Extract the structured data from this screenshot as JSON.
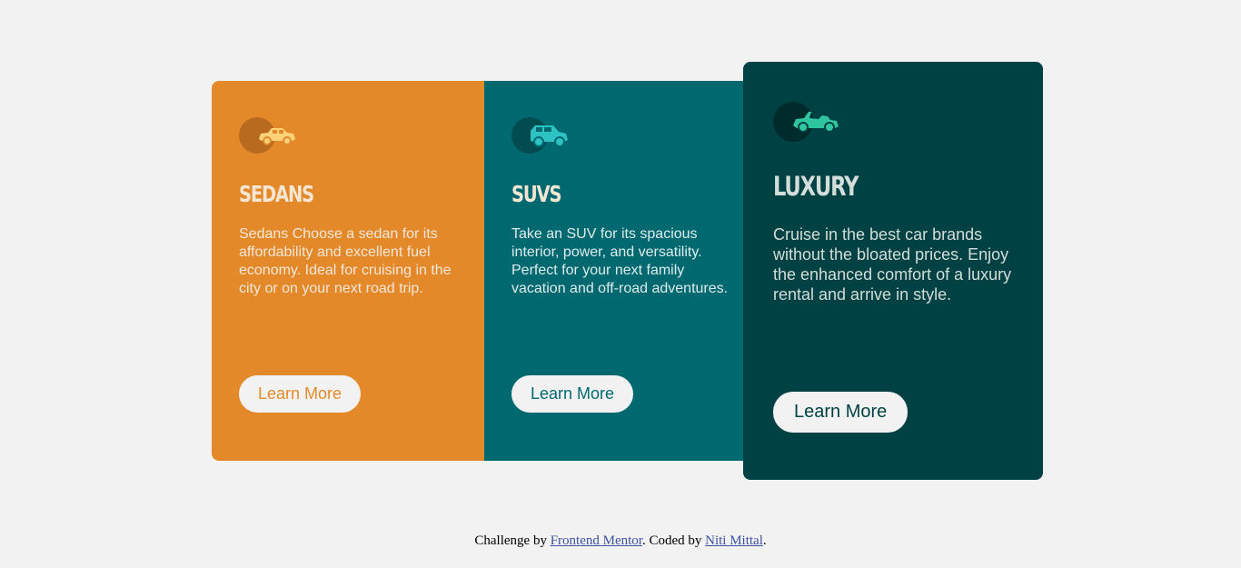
{
  "cards": [
    {
      "id": "sedans",
      "icon": "sedan-car-icon",
      "title": "SEDANS",
      "description": "Sedans Choose a sedan for its affordability and excellent fuel economy. Ideal for cruising in the city or on your next road trip.",
      "button_label": "Learn More",
      "background": "#e3892a",
      "icon_color": "#ffd27a"
    },
    {
      "id": "suvs",
      "icon": "suv-car-icon",
      "title": "SUVS",
      "description": "Take an SUV for its spacious interior, power, and versatility. Perfect for your next family vacation and off-road adventures.",
      "button_label": "Learn More",
      "background": "#006970",
      "icon_color": "#2ec2c2"
    },
    {
      "id": "luxury",
      "icon": "convertible-car-icon",
      "title": "LUXURY",
      "description": "Cruise in the best car brands without the bloated prices. Enjoy the enhanced comfort of a luxury rental and arrive in style.",
      "button_label": "Learn More",
      "background": "#004143",
      "icon_color": "#2fc59f"
    }
  ],
  "footer": {
    "prefix": "Challenge by ",
    "link1": "Frontend Mentor",
    "middle": ". Coded by ",
    "link2": "Niti Mittal",
    "suffix": "."
  }
}
